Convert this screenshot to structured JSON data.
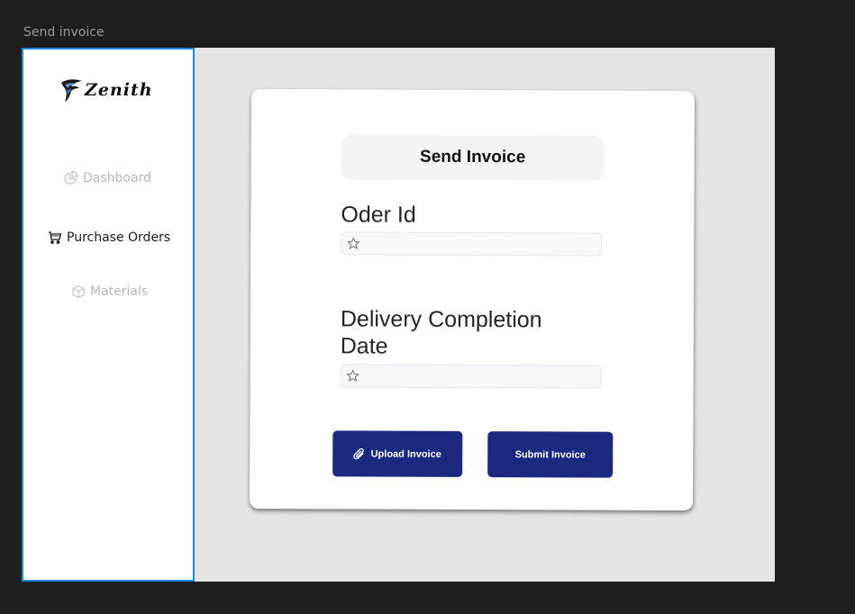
{
  "frame": {
    "label": "Send invoice"
  },
  "brand": {
    "name": "Zenith"
  },
  "sidebar": {
    "items": [
      {
        "label": "Dashboard",
        "icon": "dashboard-icon",
        "state": "inactive"
      },
      {
        "label": "Purchase Orders",
        "icon": "cart-icon",
        "state": "active"
      },
      {
        "label": "Materials",
        "icon": "cube-icon",
        "state": "inactive"
      }
    ]
  },
  "form": {
    "title": "Send Invoice",
    "order_id": {
      "label": "Oder Id",
      "value": ""
    },
    "delivery_date": {
      "label": "Delivery Completion Date",
      "value": ""
    },
    "upload_label": "Upload Invoice",
    "submit_label": "Submit Invoice"
  },
  "colors": {
    "primary": "#1b2a80",
    "sidebar_border": "#1e88e5",
    "background": "#e4e4e4"
  }
}
